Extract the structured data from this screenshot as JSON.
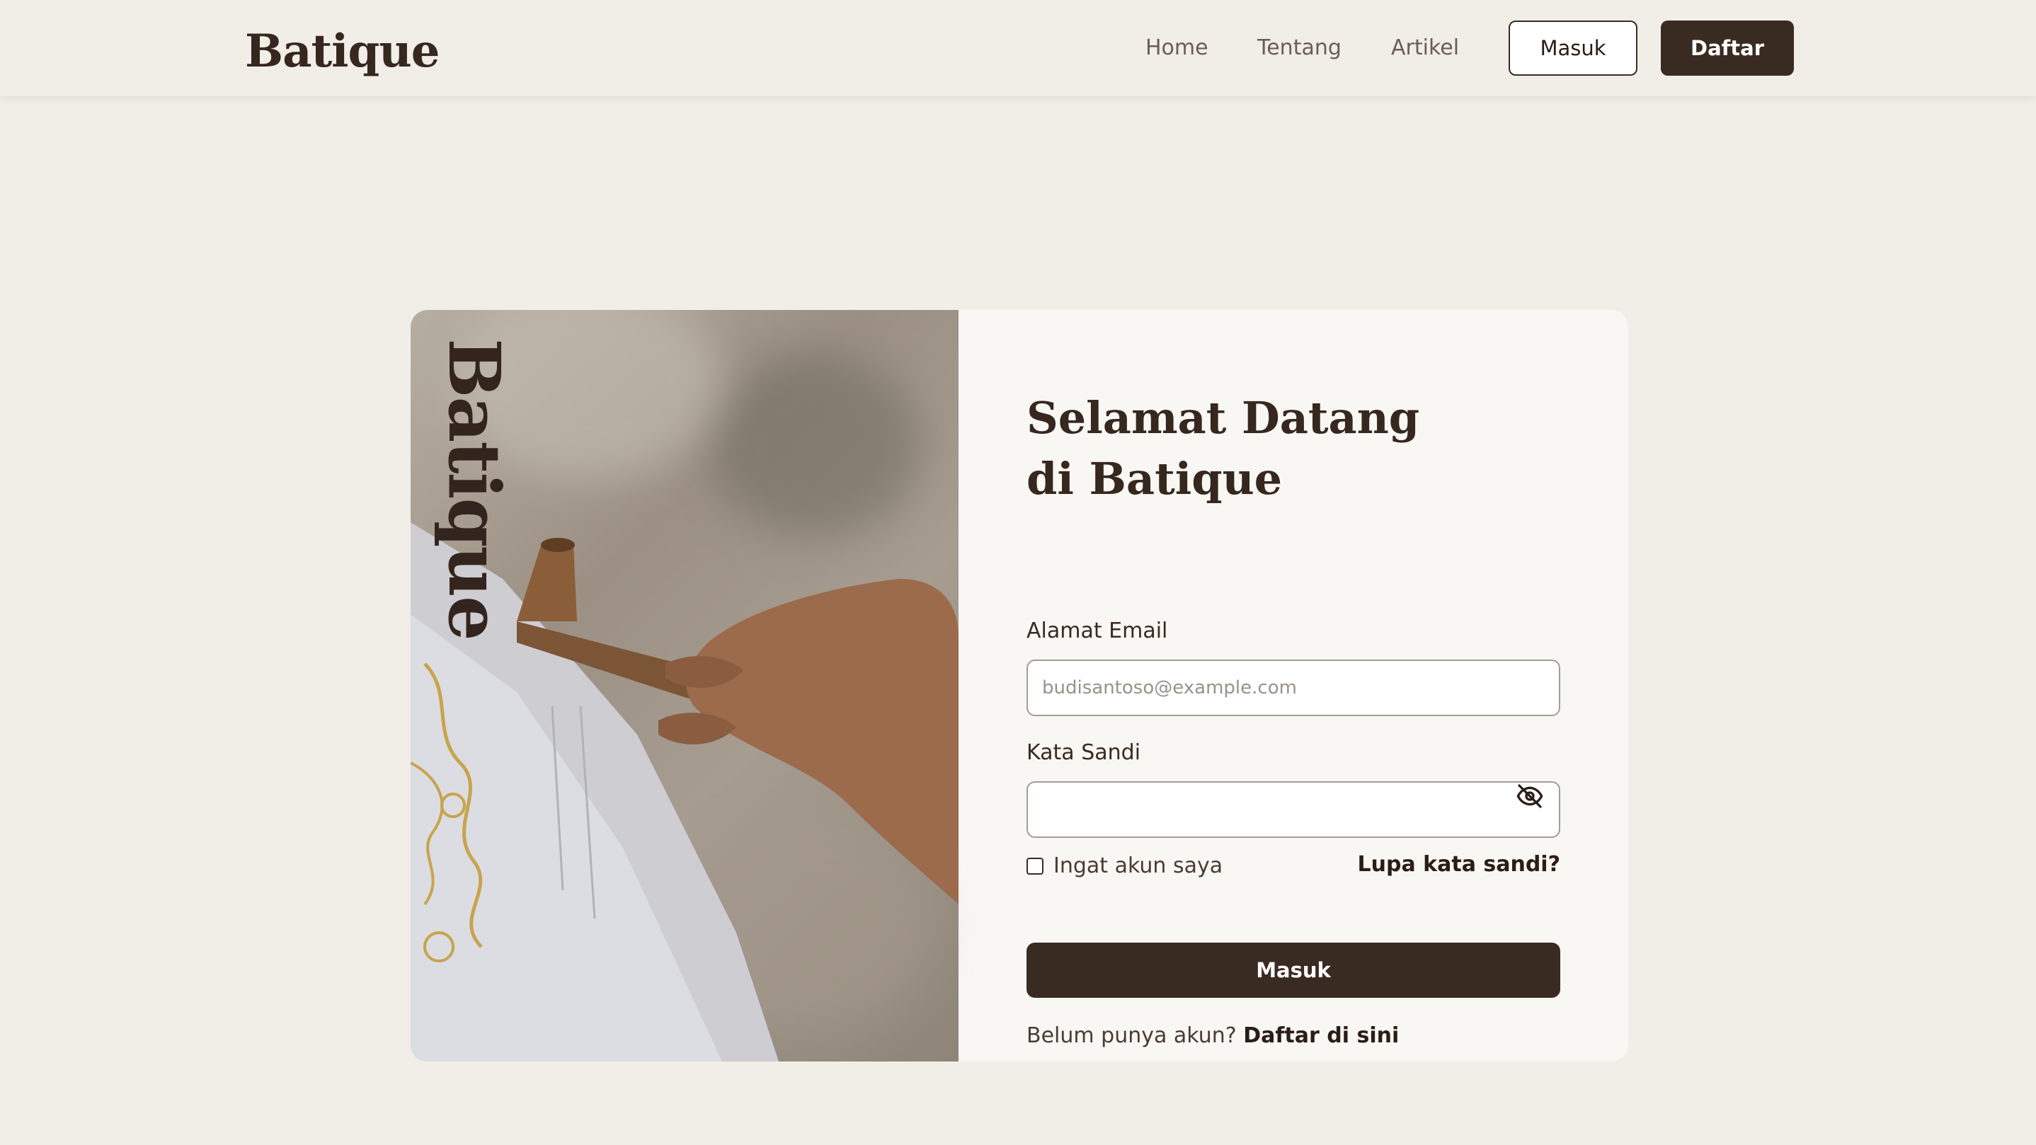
{
  "header": {
    "brand": "Batique",
    "nav": [
      {
        "label": "Home"
      },
      {
        "label": "Tentang"
      },
      {
        "label": "Artikel"
      }
    ],
    "login_label": "Masuk",
    "register_label": "Daftar"
  },
  "hero": {
    "vertical_brand": "Batique"
  },
  "form": {
    "title": "Selamat Datang di Batique",
    "email_label": "Alamat Email",
    "email_placeholder": "budisantoso@example.com",
    "email_value": "",
    "password_label": "Kata Sandi",
    "password_value": "",
    "password_icon": "eye-off-icon",
    "remember_label": "Ingat akun saya",
    "forgot_label": "Lupa kata sandi?",
    "submit_label": "Masuk",
    "signup_prompt": "Belum punya akun?",
    "signup_link": "Daftar di sini"
  },
  "colors": {
    "background": "#f1eee8",
    "primary": "#3a2b22",
    "card": "#f9f7f3"
  }
}
